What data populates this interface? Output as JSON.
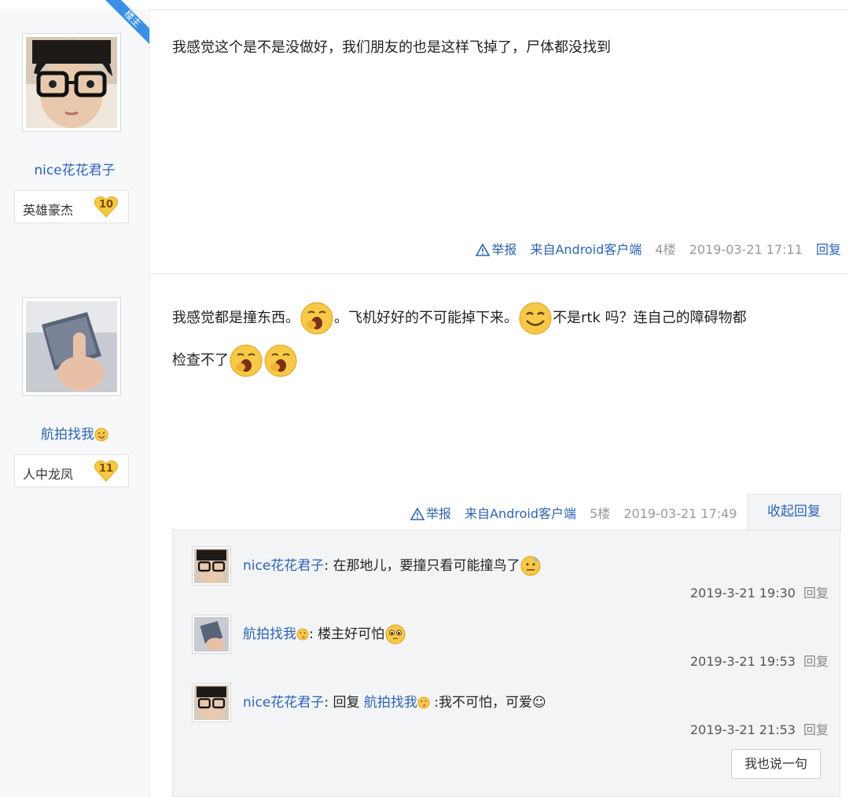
{
  "posts": [
    {
      "username": "nice花花君子",
      "rank": {
        "name": "英雄豪杰",
        "level": "10"
      },
      "louzhu_badge": "楼主",
      "content": "我感觉这个是不是没做好，我们朋友的也是这样飞掉了，尸体都没找到",
      "meta": {
        "report": "举报",
        "source": "来自Android客户端",
        "floor": "4楼",
        "time": "2019-03-21 17:11",
        "reply": "回复"
      }
    },
    {
      "username": "航拍找我",
      "rank": {
        "name": "人中龙凤",
        "level": "11"
      },
      "content_parts": [
        "我感觉都是撞东西。",
        "。飞机好好的不可能掉下来。",
        "不是rtk 吗？连自己的障碍物都",
        "检查不了"
      ],
      "meta": {
        "report": "举报",
        "source": "来自Android客户端",
        "floor": "5楼",
        "time": "2019-03-21 17:49",
        "toggle": "收起回复"
      },
      "replies": [
        {
          "user": "nice花花君子",
          "text": "在那地儿，要撞只看可能撞鸟了",
          "time": "2019-3-21 19:30",
          "reply": "回复"
        },
        {
          "user": "航拍找我",
          "text": "楼主好可怕",
          "time": "2019-3-21 19:53",
          "reply": "回复"
        },
        {
          "user": "nice花花君子",
          "reply_prefix": "回复",
          "reply_to": "航拍找我",
          "text": ":我不可怕，可爱☺",
          "time": "2019-3-21 21:53",
          "reply": "回复"
        }
      ],
      "say_button": "我也说一句"
    }
  ],
  "colors": {
    "link": "#2d64b3",
    "sidebar_bg": "#f7f8fa",
    "reply_panel_bg": "#f3f4f6",
    "louzhu_badge": "#3a8fe6",
    "rank_badge": "#f5c842"
  }
}
